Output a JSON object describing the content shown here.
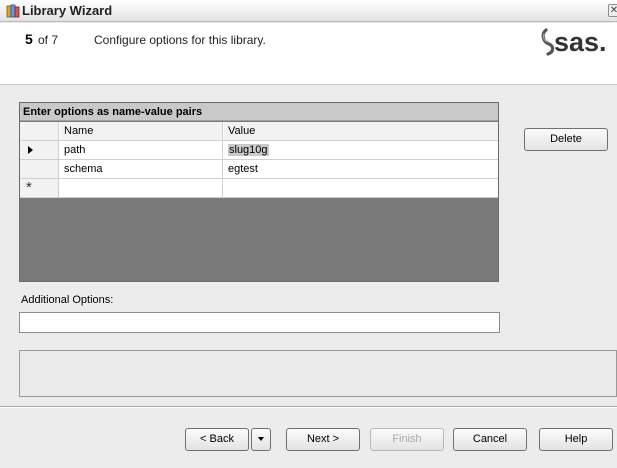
{
  "window": {
    "title": "Library Wizard",
    "close_glyph": "✕"
  },
  "header": {
    "step_current": "5",
    "step_of": "of 7",
    "step_title": "Configure options for this library.",
    "logo_text": "sas."
  },
  "grid": {
    "caption": "Enter options as name-value pairs",
    "columns": [
      "Name",
      "Value"
    ],
    "rows": [
      {
        "name": "path",
        "value": "slug10g",
        "current": true
      },
      {
        "name": "schema",
        "value": "egtest",
        "current": false
      }
    ],
    "new_row_marker": "*"
  },
  "buttons": {
    "delete": "Delete",
    "back": "< Back",
    "next": "Next >",
    "finish": "Finish",
    "cancel": "Cancel",
    "help": "Help"
  },
  "additional_options": {
    "label": "Additional Options:",
    "value": ""
  },
  "icons": {
    "title": "library-icon",
    "close": "close-icon",
    "current_row": "row-pointer-icon",
    "back_dropdown": "chevron-down-icon"
  },
  "colors": {
    "grid_background": "#7a7a7a",
    "selection_highlight": "#c9c9c9"
  }
}
